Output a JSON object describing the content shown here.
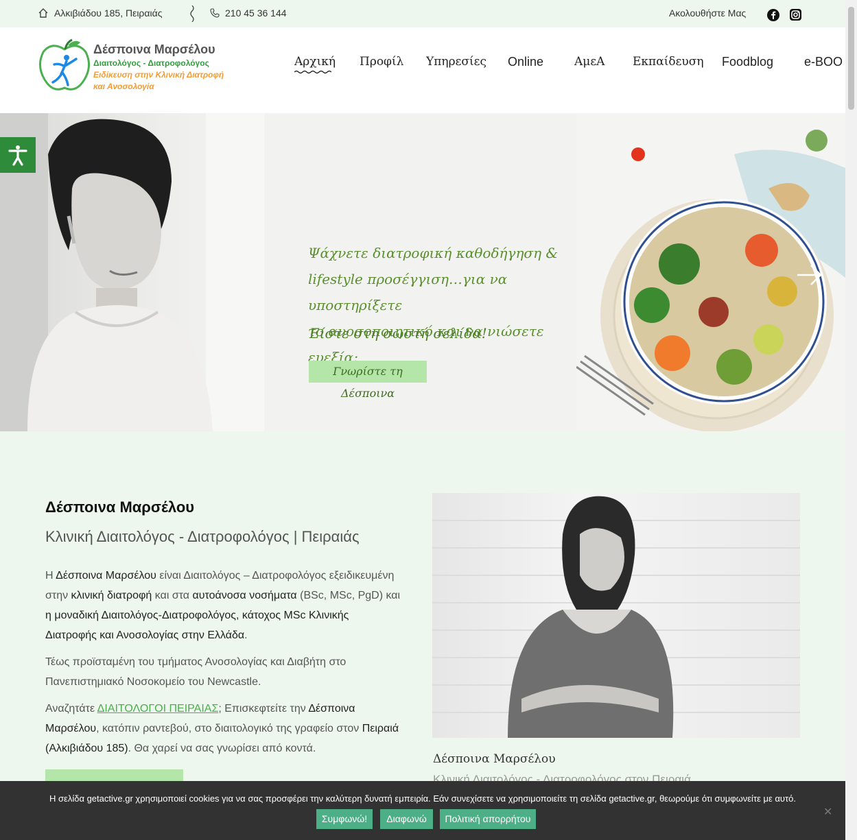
{
  "topbar": {
    "address": "Αλκιβιάδου 185, Πειραιάς",
    "phone": "210 45 36 144",
    "follow": "Ακολουθήστε Μας"
  },
  "logo": {
    "title": "Δέσποινα Μαρσέλου",
    "subtitle": "Διαιτολόγος - Διατροφολόγος",
    "specialty_line1": "Ειδίκευση στην Κλινική Διατροφή",
    "specialty_line2": "και Ανοσολογία"
  },
  "nav": {
    "items": [
      "Αρχική",
      "Προφίλ",
      "Υπηρεσίες",
      "Online",
      "ΑμεΑ",
      "Εκπαίδευση",
      "Foodblog",
      "e-BOO"
    ]
  },
  "hero": {
    "line1": "Ψάχνετε διατροφική καθοδήγηση &",
    "line2": "lifestyle προσέγγιση…για να υποστηρίξετε",
    "line3": "το ανοσοποιητικό και να νιώσετε ευεξία;",
    "line4": "Είστε στη σωστή σελίδα!",
    "button": "Γνωρίστε τη Δέσποινα"
  },
  "about": {
    "name": "Δέσποινα Μαρσέλου",
    "role": "Κλινική Διαιτολόγος - Διατροφολόγος | Πειραιάς",
    "p1_a": "Η ",
    "p1_b": "Δέσποινα Μαρσέλου",
    "p1_c": " είναι Διαιτολόγος – Διατροφολόγος εξειδικευμένη στην ",
    "p1_d": "κλινική διατροφή",
    "p1_e": " και στα ",
    "p1_f": "αυτοάνοσα νοσήματα",
    "p1_g": " (BSc, MSc, PgD) και ",
    "p1_h": "η μοναδική Διαιτολόγος-Διατροφολόγος, κάτοχος MSc Κλινικής Διατροφής και Ανοσολογίας στην Ελλάδα",
    "p1_i": ".",
    "p2": "Τέως προϊσταμένη του τμήματος Ανοσολογίας και Διαβήτη στο Πανεπιστημιακό Νοσοκομείο του Newcastle.",
    "p3_a": "Αναζητάτε ",
    "p3_link": "ΔΙΑΙΤΟΛΟΓΟΙ ΠΕΙΡΑΙΑΣ",
    "p3_b": "; Επισκεφτείτε την ",
    "p3_c": "Δέσποινα Μαρσέλου",
    "p3_d": ", κατόπιν ραντεβού, στο διαιτολογικό της γραφείο στον ",
    "p3_e": "Πειραιά (Αλκιβιάδου 185)",
    "p3_f": ". Θα χαρεί να σας γνωρίσει από κοντά.",
    "caption_name": "Δέσποινα Μαρσέλου",
    "caption_role": "Κλινική Διαιτολόγος - Διατροφολόγος στον Πειραιά"
  },
  "cookie": {
    "text": "Η σελίδα getactive.gr χρησιμοποιεί cookies για να σας προσφέρει την καλύτερη δυνατή εμπειρία. Εάν συνεχίσετε να χρησιμοποιείτε τη σελίδα getactive.gr, θεωρούμε ότι συμφωνείτε με αυτό.",
    "accept": "Συμφωνώ!",
    "decline": "Διαφωνώ",
    "policy": "Πολιτική απορρήτου",
    "close": "✕"
  },
  "colors": {
    "brand_green": "#2e9e3a",
    "brand_orange": "#f39c33",
    "hero_text": "#5b8f2e",
    "button_light_green": "#b3e6a8",
    "cookie_button": "#4caf86",
    "page_bg": "#eef7ee"
  },
  "icons": [
    "home-icon",
    "phone-icon",
    "facebook-icon",
    "instagram-icon",
    "accessibility-icon",
    "chevron-right-icon",
    "close-icon"
  ]
}
